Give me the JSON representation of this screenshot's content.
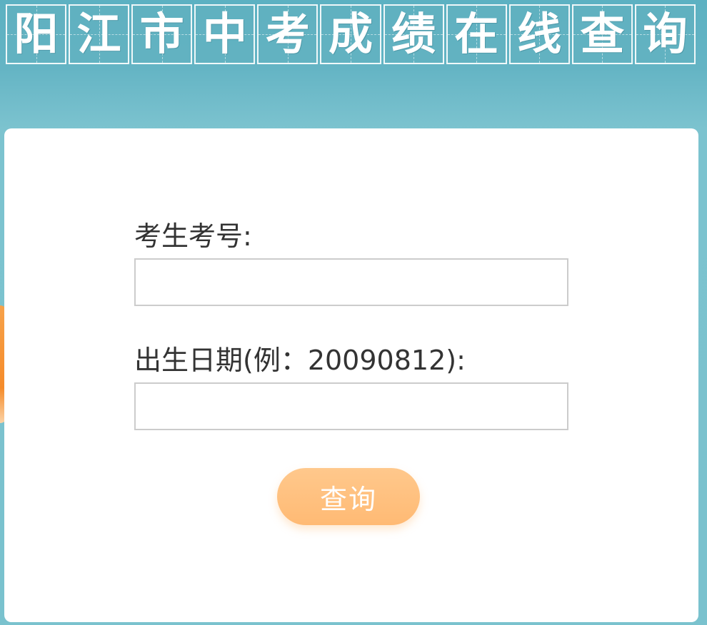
{
  "header": {
    "title_chars": [
      "阳",
      "江",
      "市",
      "中",
      "考",
      "成",
      "绩",
      "在",
      "线",
      "查",
      "询"
    ]
  },
  "form": {
    "exam_number_label": "考生考号:",
    "exam_number_value": "",
    "birth_date_label": "出生日期(例：20090812):",
    "birth_date_value": "",
    "submit_label": "查询"
  },
  "colors": {
    "background": "#7ac2ce",
    "header_tile": "#62b0c0",
    "card": "#ffffff",
    "button": "#ffbf7c",
    "label_text": "#333333",
    "input_border": "#cccccc",
    "side_accent": "#f58b2a"
  }
}
